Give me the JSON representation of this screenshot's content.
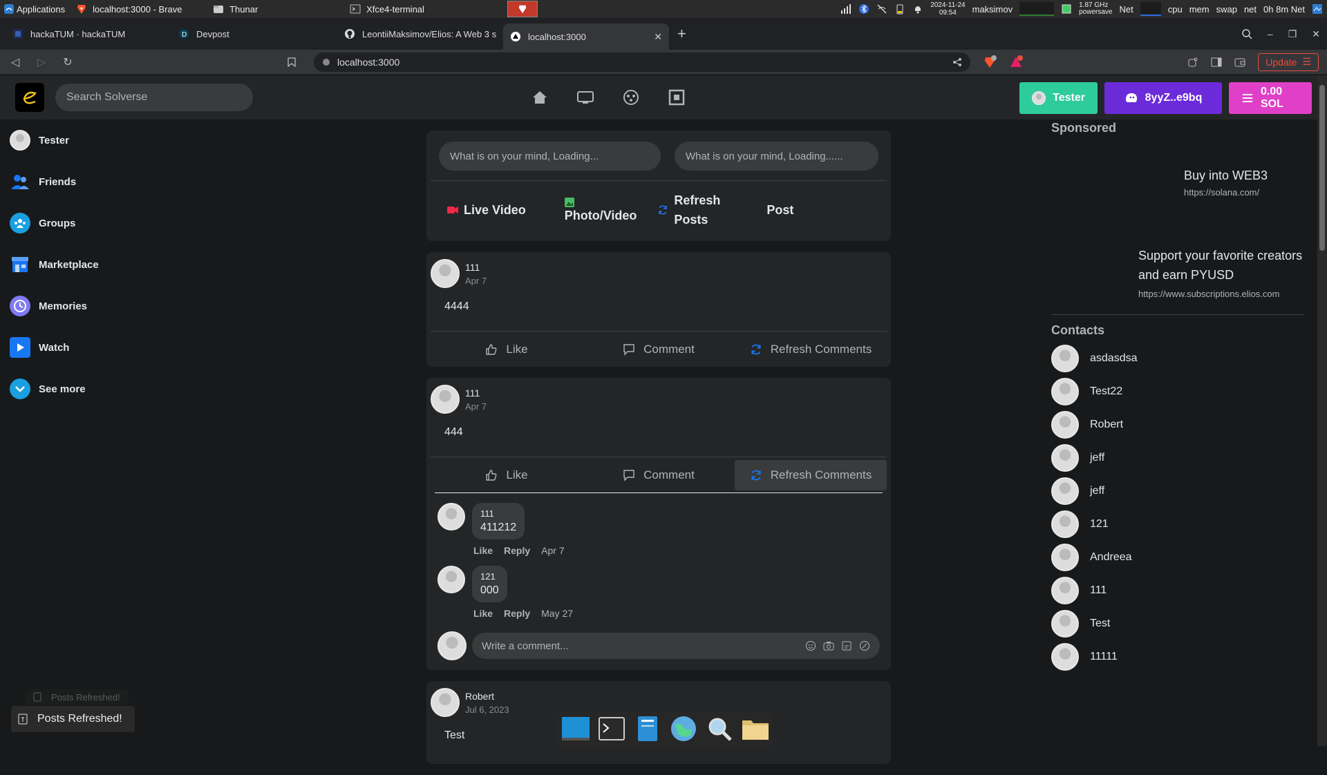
{
  "xfce_panel": {
    "applications_label": "Applications",
    "tasks": [
      {
        "label": "localhost:3000 - Brave",
        "active": false
      },
      {
        "label": "Thunar",
        "active": false
      },
      {
        "label": "Xfce4-terminal",
        "active": false
      }
    ],
    "clock_date": "2024-11-24",
    "clock_time": "09:54",
    "user": "maksimov",
    "cpu_freq": "1.87 GHz",
    "cpu_governor": "powersave",
    "net_label": "Net",
    "monitor_labels": [
      "cpu",
      "mem",
      "swap",
      "net"
    ],
    "uptime_label": "0h 8m Net"
  },
  "browser": {
    "tabs": [
      {
        "label": "hackaTUM · hackaTUM",
        "icon": "hackatum-icon",
        "active": false
      },
      {
        "label": "Devpost",
        "icon": "devpost-icon",
        "active": false
      },
      {
        "label": "LeontiiMaksimov/Elios: A Web 3 s",
        "icon": "github-icon",
        "active": false
      },
      {
        "label": "localhost:3000",
        "icon": "react-icon",
        "active": true
      }
    ],
    "url": "localhost:3000",
    "update_label": "Update",
    "shield_badge": "1",
    "rewards_badge": "1"
  },
  "app": {
    "search_placeholder": "Search Solverse",
    "header_buttons": {
      "profile": "Tester",
      "wallet": "8yyZ..e9bq",
      "balance": "0.00 SOL"
    },
    "sidebar": [
      {
        "label": "Tester",
        "icon": "avatar-icon",
        "color": "#dddddd"
      },
      {
        "label": "Friends",
        "icon": "friends-icon",
        "color": "#1877f2"
      },
      {
        "label": "Groups",
        "icon": "groups-icon",
        "color": "#1877f2"
      },
      {
        "label": "Marketplace",
        "icon": "marketplace-icon",
        "color": "#1877f2"
      },
      {
        "label": "Memories",
        "icon": "memories-icon",
        "color": "#6b8cff"
      },
      {
        "label": "Watch",
        "icon": "watch-icon",
        "color": "#1877f2"
      },
      {
        "label": "See more",
        "icon": "see-more-icon",
        "color": "#1877f2"
      }
    ],
    "composer": {
      "placeholder_1": "What is on your mind, Loading...",
      "placeholder_2": "What is on your mind, Loading......",
      "live_video": "Live Video",
      "photo_video": "Photo/Video",
      "refresh_posts": "Refresh Posts",
      "post": "Post"
    },
    "post_actions": {
      "like": "Like",
      "comment": "Comment",
      "refresh_comments": "Refresh Comments"
    },
    "posts": [
      {
        "author": "111",
        "date": "Apr 7",
        "text": "4444"
      },
      {
        "author": "111",
        "date": "Apr 7",
        "text": "444",
        "comments": [
          {
            "author": "111",
            "text": "411212",
            "like": "Like",
            "reply": "Reply",
            "date": "Apr 7"
          },
          {
            "author": "121",
            "text": "000",
            "like": "Like",
            "reply": "Reply",
            "date": "May 27"
          }
        ],
        "write_placeholder": "Write a comment..."
      },
      {
        "author": "Robert",
        "date": "Jul 6, 2023",
        "text": "Test"
      }
    ],
    "sponsored": {
      "title": "Sponsored",
      "ads": [
        {
          "title": "Buy into WEB3",
          "url": "https://solana.com/"
        },
        {
          "title": "Support your favorite creators and earn PYUSD",
          "url": "https://www.subscriptions.elios.com"
        }
      ]
    },
    "contacts": {
      "title": "Contacts",
      "names": [
        "asdasdsa",
        "Test22",
        "Robert",
        "jeff",
        "jeff",
        "121",
        "Andreea",
        "111",
        "Test",
        "11111"
      ]
    },
    "toasts": {
      "ghost": "Posts Refreshed!",
      "main": "Posts Refreshed!"
    }
  }
}
